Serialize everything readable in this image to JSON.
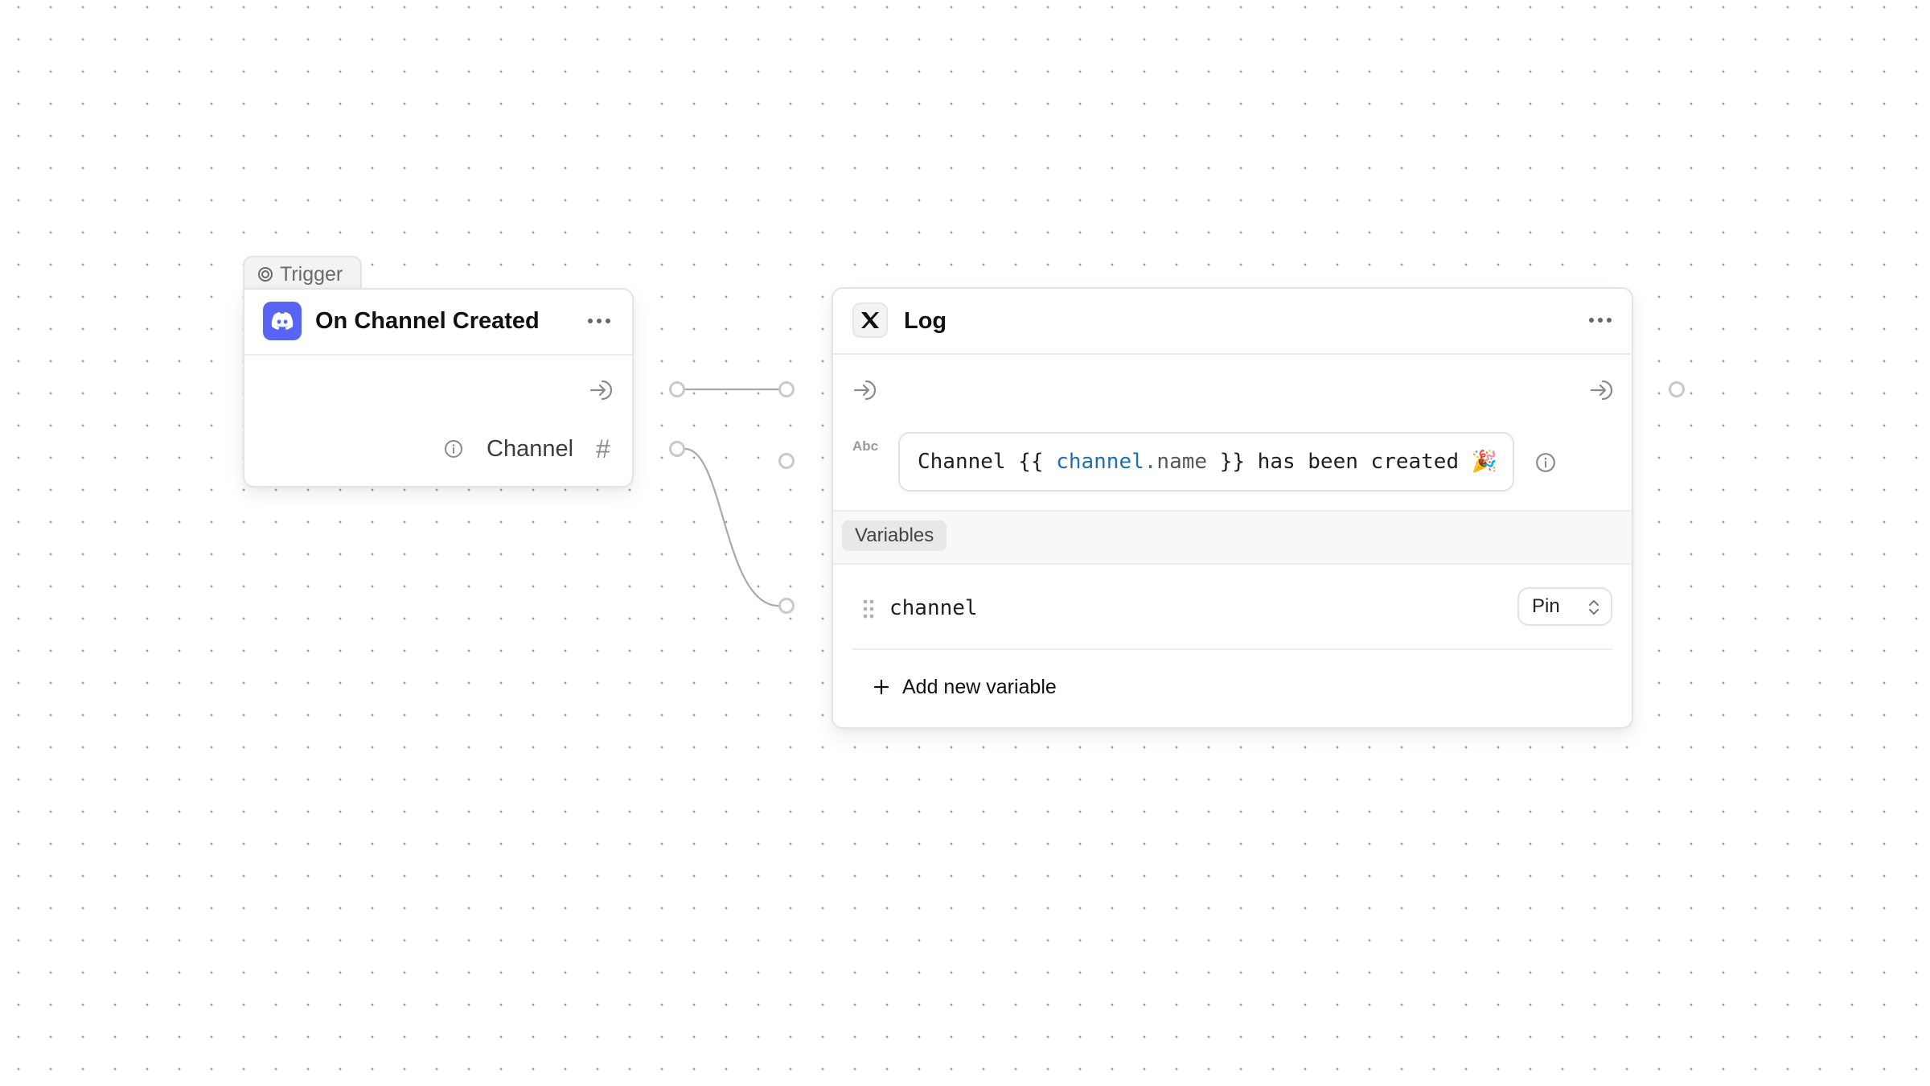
{
  "trigger_node": {
    "tab_label": "Trigger",
    "tab_icon": "target-icon",
    "app_icon": "discord-icon",
    "brand_color": "#5865F2",
    "title": "On Channel Created",
    "menu_icon": "more-horizontal-icon",
    "exec_output_icon": "arrow-right-into-icon",
    "outputs": [
      {
        "label": "Channel",
        "type_icon": "hash-icon",
        "type_glyph": "#",
        "info_icon": "info-icon"
      }
    ]
  },
  "log_node": {
    "app_icon": "x-logo-icon",
    "title": "Log",
    "menu_icon": "more-horizontal-icon",
    "exec_input_icon": "arrow-right-into-icon",
    "exec_output_icon": "arrow-right-into-icon",
    "message_input": {
      "type_badge": "Abc",
      "prefix": "Channel {{ ",
      "var_object": "channel",
      "var_dot": ".",
      "var_prop": "name",
      "suffix": " }} has been created ",
      "emoji": "🎉",
      "var_color": "#1f6fb2"
    },
    "variables_section": {
      "label": "Variables",
      "items": [
        {
          "name": "channel",
          "mode": "Pin"
        }
      ],
      "add_label": "Add new variable"
    }
  },
  "connections": [
    {
      "from": "trigger.exec",
      "to": "log.exec_in"
    },
    {
      "from": "trigger.channel",
      "to": "log.variables.channel"
    }
  ]
}
